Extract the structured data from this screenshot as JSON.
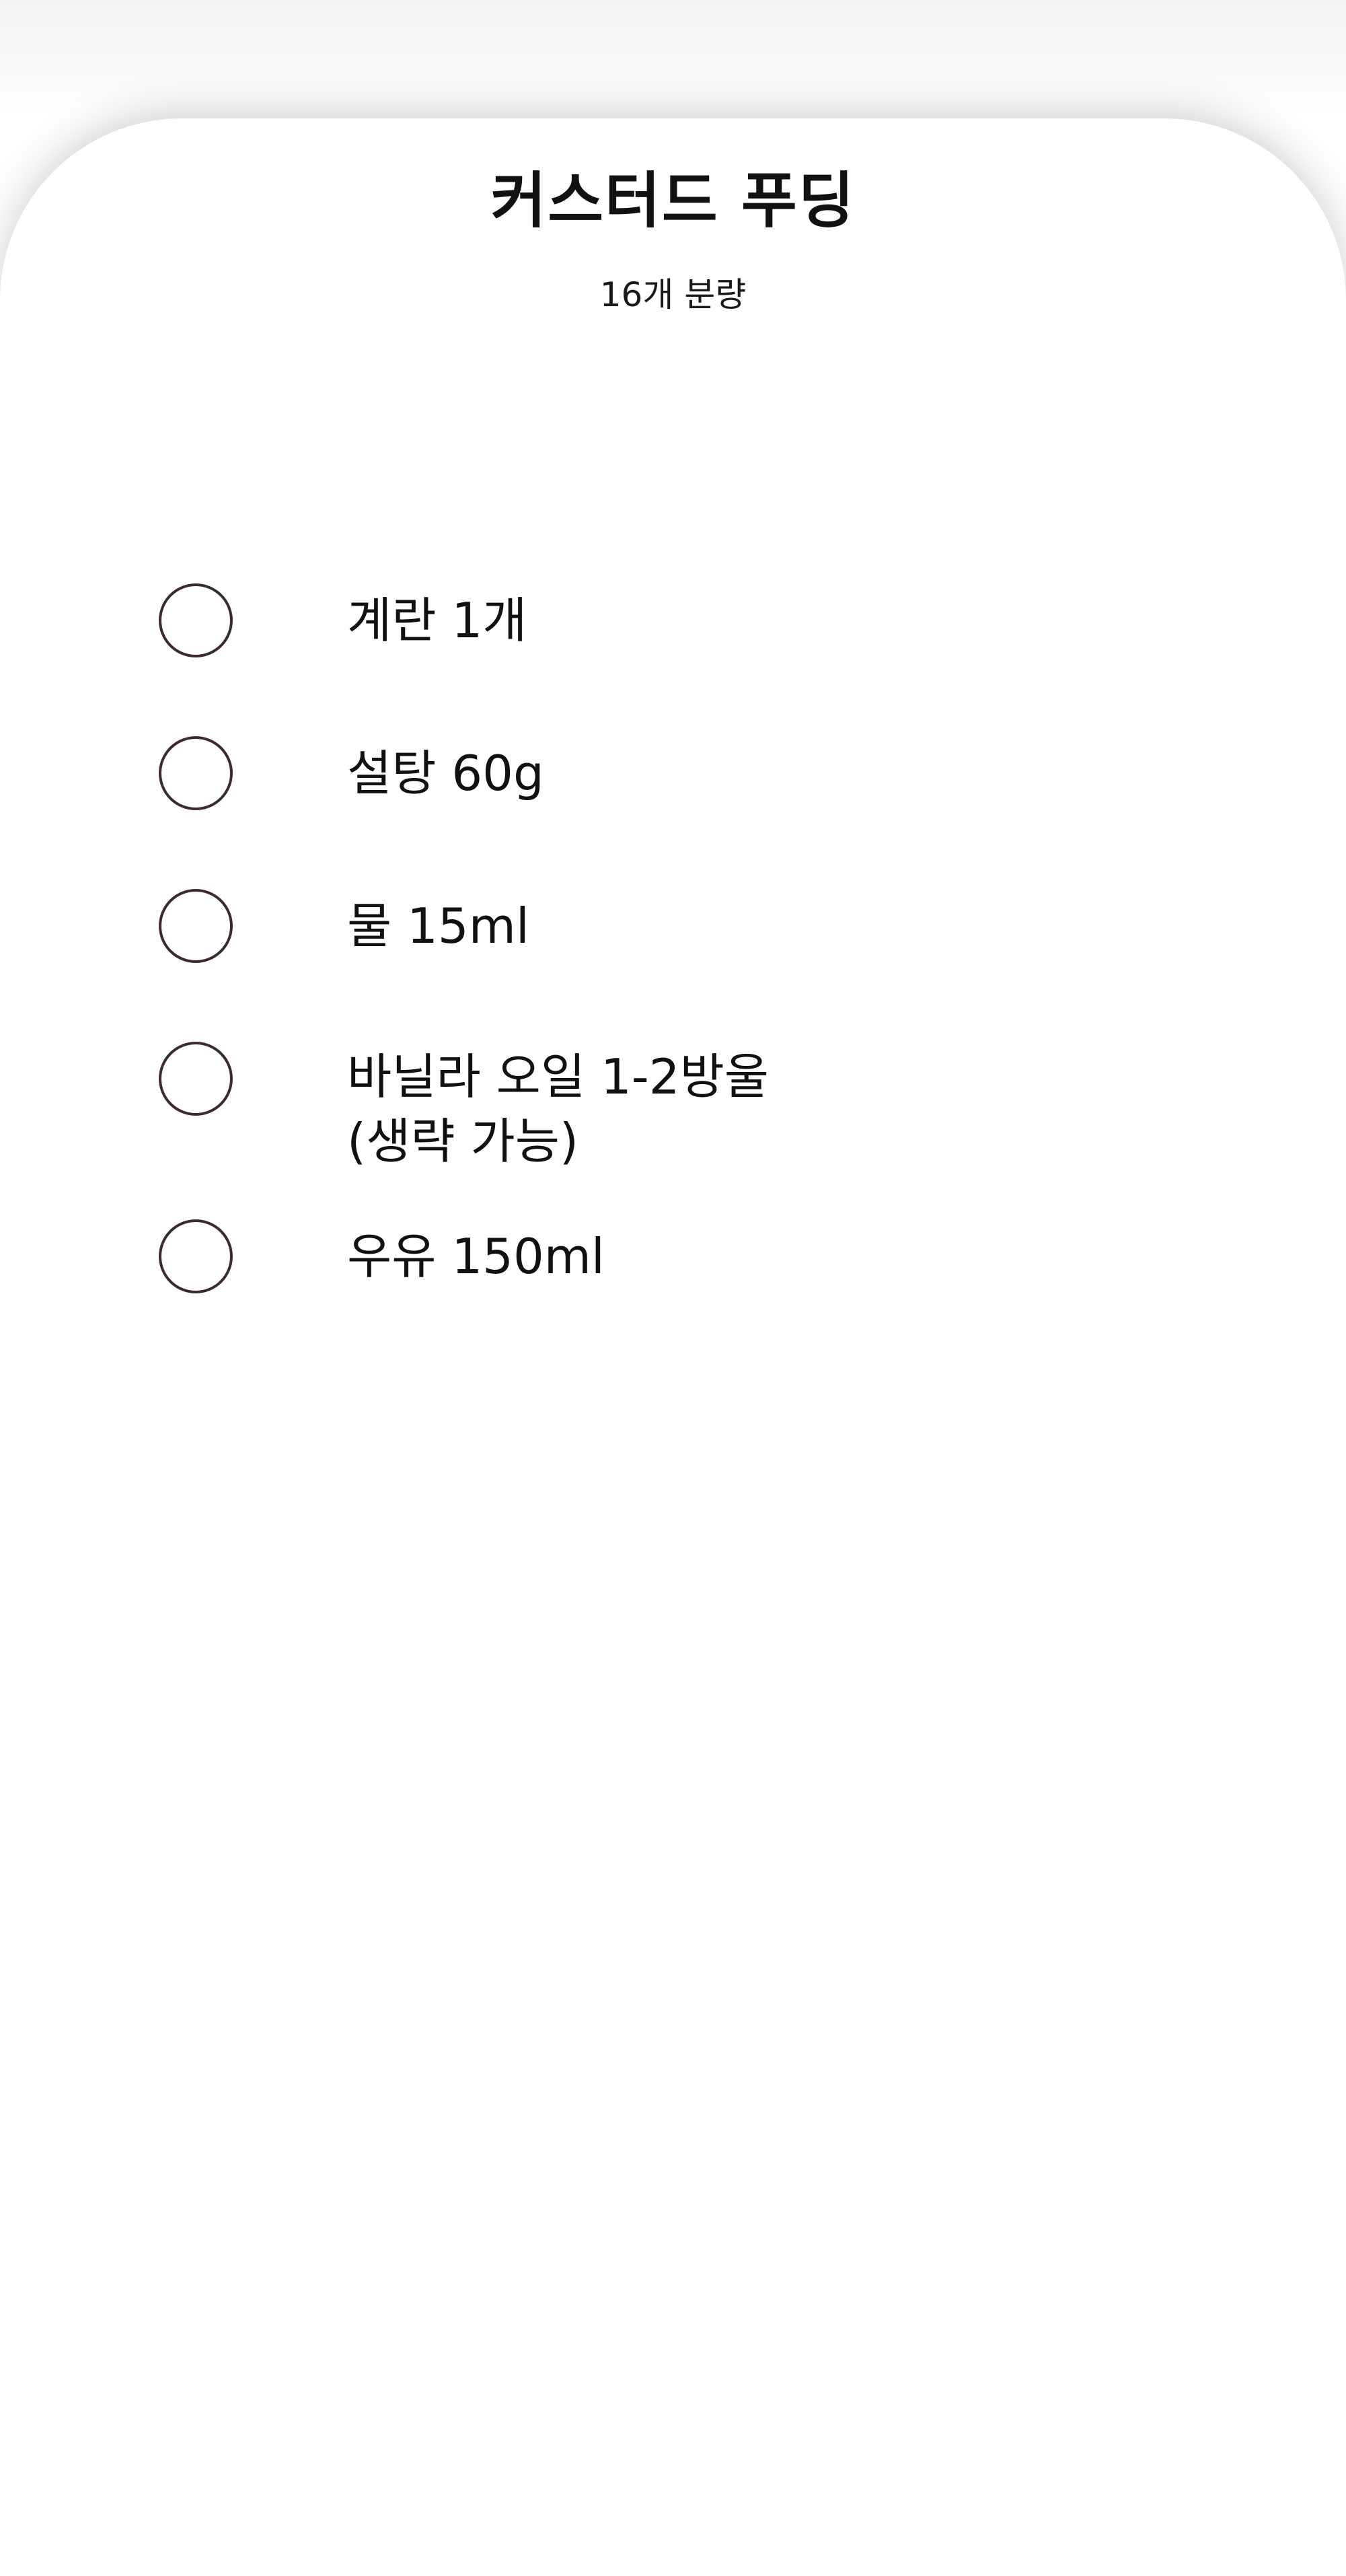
{
  "recipe": {
    "title": "커스터드 푸딩",
    "yield": "16개 분량"
  },
  "ingredients": [
    {
      "label": "계란 1개",
      "checked": false
    },
    {
      "label": "설탕 60g",
      "checked": false
    },
    {
      "label": "물 15ml",
      "checked": false
    },
    {
      "label": "바닐라 오일 1-2방울\n(생략 가능)",
      "checked": false
    },
    {
      "label": "우유 150ml",
      "checked": false
    }
  ],
  "colors": {
    "checkbox_border": "#3b2b30",
    "text": "#111111",
    "background": "#ffffff"
  }
}
